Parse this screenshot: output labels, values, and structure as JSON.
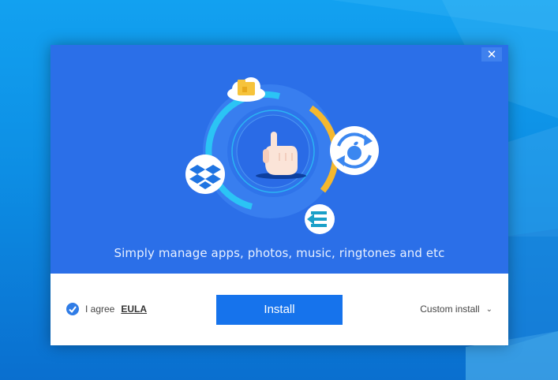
{
  "installer": {
    "tagline": "Simply manage apps, photos, music, ringtones and etc",
    "close_symbol": "✕",
    "agree_label": "I agree",
    "eula_label": "EULA",
    "install_label": "Install",
    "custom_install_label": "Custom install",
    "agree_checked": true
  },
  "icons": {
    "cloud_folder": "cloud-folder-icon",
    "dropbox": "dropbox-icon",
    "apple_sync": "apple-sync-icon",
    "eu_app": "e-arrow-icon",
    "pointing_hand": "pointing-hand-icon"
  },
  "colors": {
    "hero_background": "#2b6fe8",
    "install_button": "#1673ec",
    "ring_cyan": "#2bc4f5",
    "ring_yellow": "#f5b82e",
    "desktop": "#0d8ee4"
  }
}
